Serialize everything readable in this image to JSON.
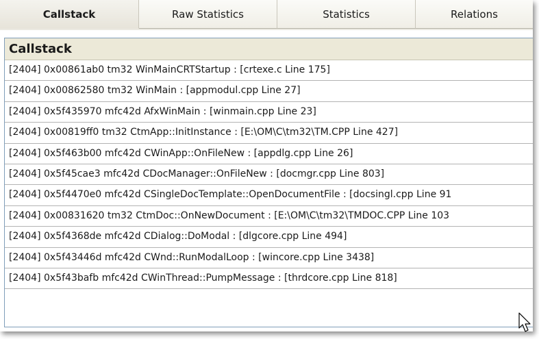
{
  "tabs": [
    {
      "label": "Callstack",
      "active": true
    },
    {
      "label": "Raw Statistics",
      "active": false
    },
    {
      "label": "Statistics",
      "active": false
    },
    {
      "label": "Relations",
      "active": false
    }
  ],
  "panel": {
    "header": "Callstack",
    "rows": [
      "[2404] 0x00861ab0 tm32 WinMainCRTStartup : [crtexe.c Line 175]",
      "[2404] 0x00862580 tm32 WinMain : [appmodul.cpp Line 27]",
      "[2404] 0x5f435970 mfc42d AfxWinMain : [winmain.cpp Line 23]",
      "[2404] 0x00819ff0 tm32 CtmApp::InitInstance : [E:\\OM\\C\\tm32\\TM.CPP Line 427]",
      "[2404] 0x5f463b00 mfc42d CWinApp::OnFileNew : [appdlg.cpp Line 26]",
      "[2404] 0x5f45cae3 mfc42d CDocManager::OnFileNew : [docmgr.cpp Line 803]",
      "[2404] 0x5f4470e0 mfc42d CSingleDocTemplate::OpenDocumentFile : [docsingl.cpp Line 91",
      "[2404] 0x00831620 tm32 CtmDoc::OnNewDocument : [E:\\OM\\C\\tm32\\TMDOC.CPP Line 103",
      "[2404] 0x5f4368de mfc42d CDialog::DoModal : [dlgcore.cpp Line 494]",
      "[2404] 0x5f43446d mfc42d CWnd::RunModalLoop : [wincore.cpp Line 3438]",
      "[2404] 0x5f43bafb mfc42d CWinThread::PumpMessage : [thrdcore.cpp Line 818]"
    ]
  },
  "icons": {
    "cursor": "mouse-pointer-icon"
  }
}
